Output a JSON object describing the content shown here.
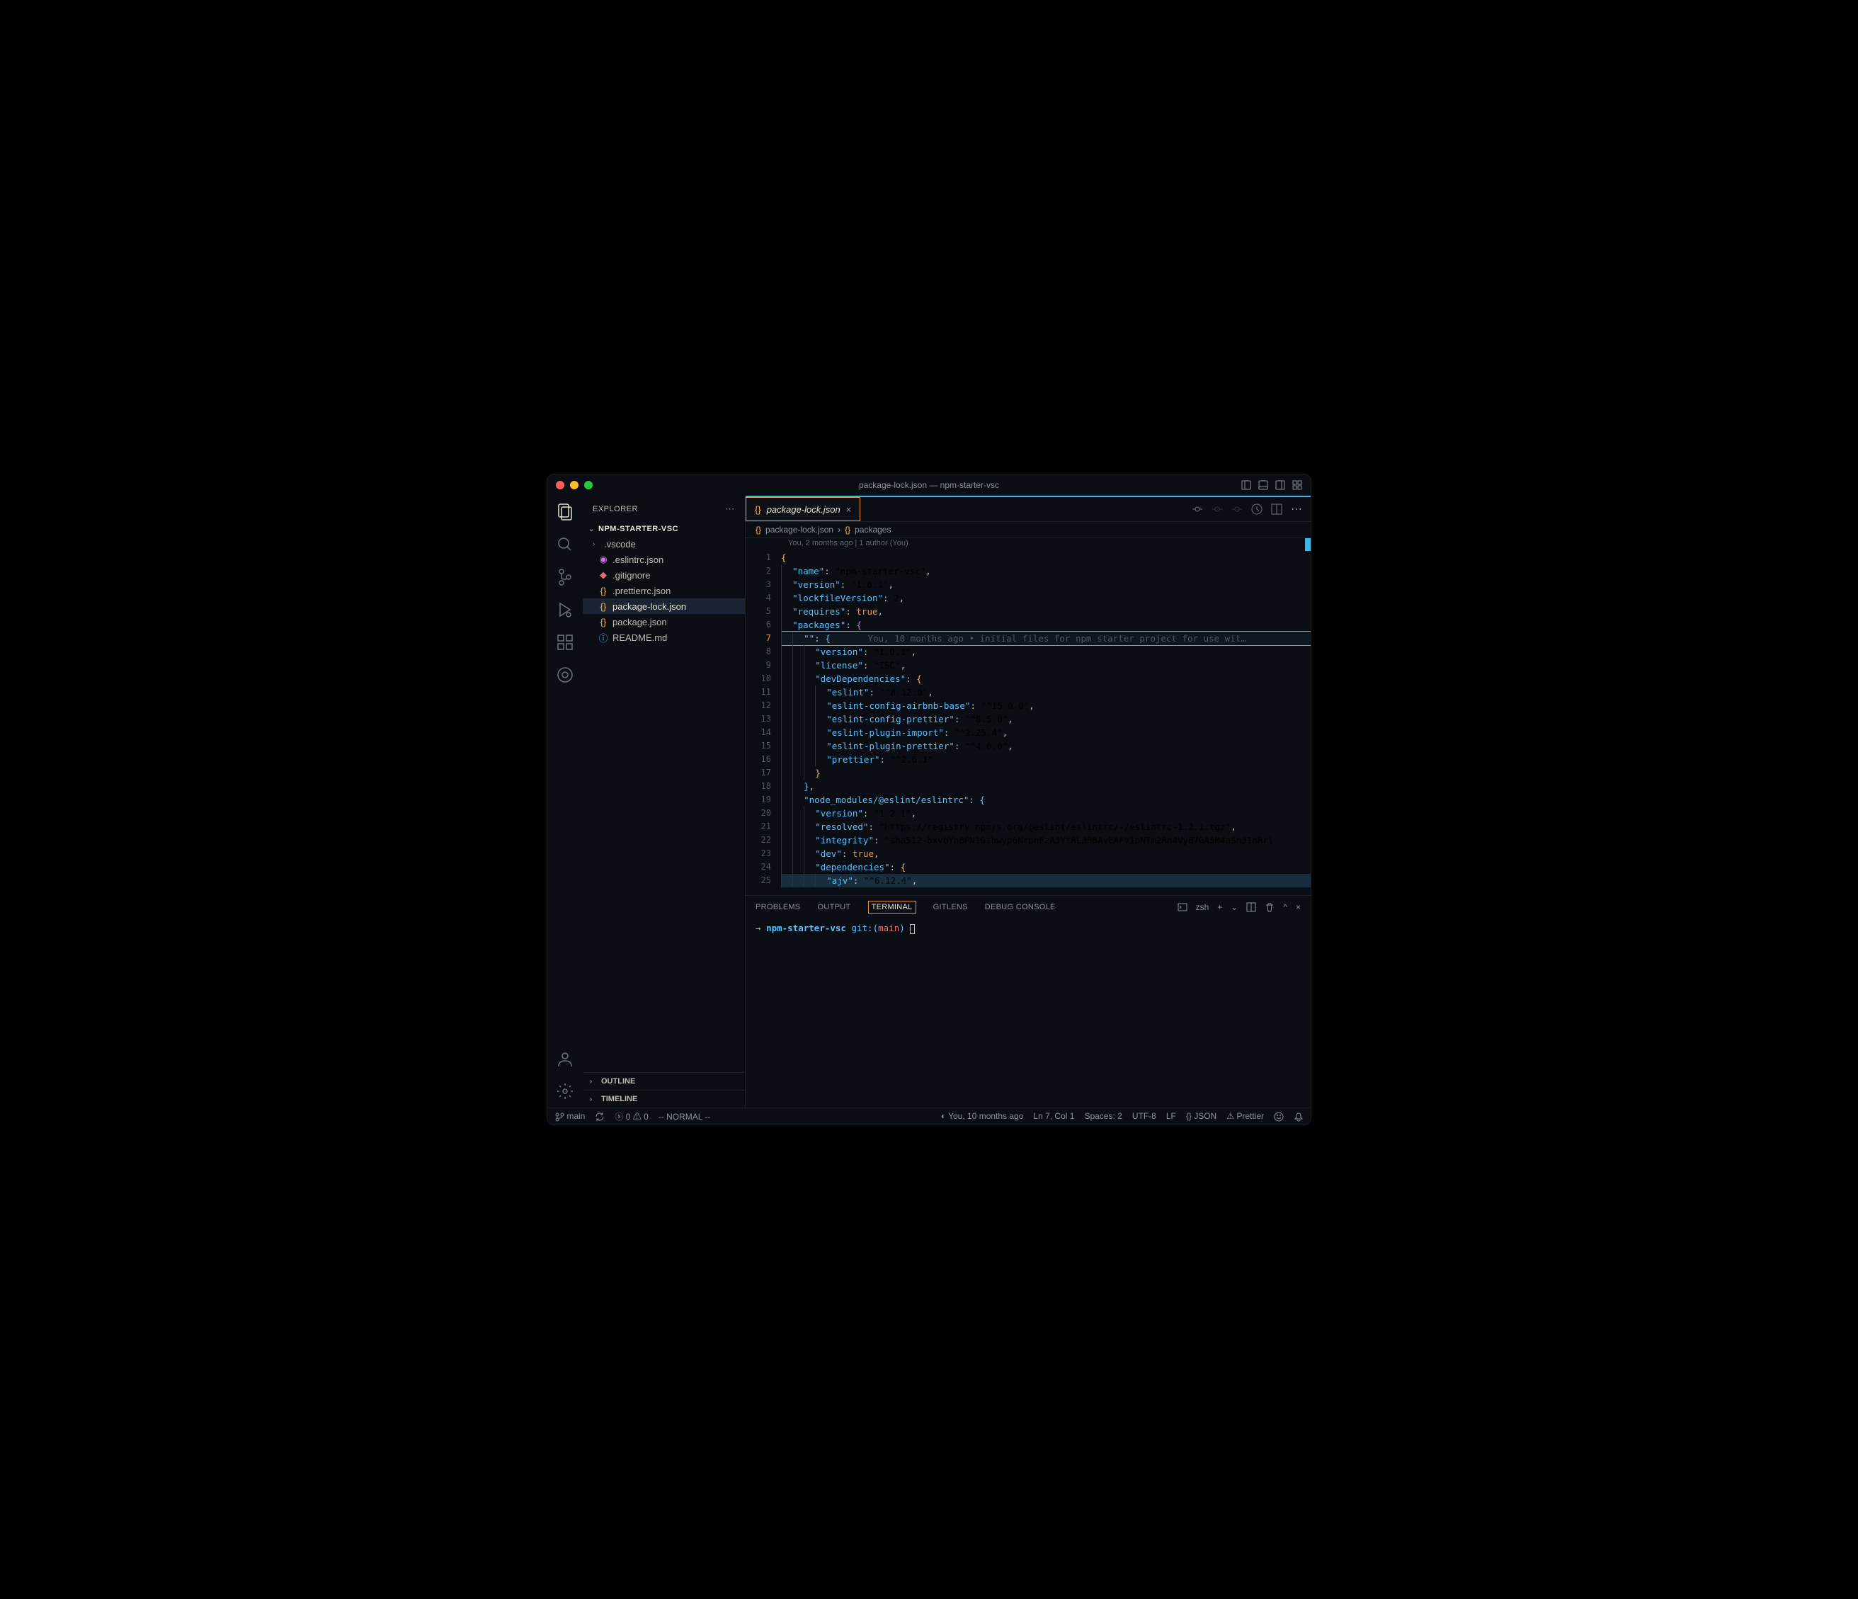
{
  "titlebar": {
    "title": "package-lock.json — npm-starter-vsc"
  },
  "sidebar": {
    "header": "EXPLORER",
    "folder": "NPM-STARTER-VSC",
    "items": [
      {
        "label": ".vscode",
        "type": "folder"
      },
      {
        "label": ".eslintrc.json",
        "type": "file",
        "icon": "settings"
      },
      {
        "label": ".gitignore",
        "type": "file",
        "icon": "git"
      },
      {
        "label": ".prettierrc.json",
        "type": "file",
        "icon": "json"
      },
      {
        "label": "package-lock.json",
        "type": "file",
        "icon": "json",
        "active": true
      },
      {
        "label": "package.json",
        "type": "file",
        "icon": "json"
      },
      {
        "label": "README.md",
        "type": "file",
        "icon": "info"
      }
    ],
    "outline": "OUTLINE",
    "timeline": "TIMELINE"
  },
  "tabs": {
    "active": {
      "label": "package-lock.json"
    }
  },
  "breadcrumb": {
    "parts": [
      "package-lock.json",
      "packages"
    ]
  },
  "blame": {
    "header": "You, 2 months ago | 1 author (You)",
    "inline": "You, 10 months ago • initial files for npm starter project for use wit…"
  },
  "code": {
    "lines": [
      "{",
      "  \"name\": \"npm-starter-vsc\",",
      "  \"version\": \"1.0.1\",",
      "  \"lockfileVersion\": 2,",
      "  \"requires\": true,",
      "  \"packages\": {",
      "    \"\": {",
      "      \"version\": \"1.0.1\",",
      "      \"license\": \"ISC\",",
      "      \"devDependencies\": {",
      "        \"eslint\": \"^8.12.0\",",
      "        \"eslint-config-airbnb-base\": \"^15.0.0\",",
      "        \"eslint-config-prettier\": \"^8.5.0\",",
      "        \"eslint-plugin-import\": \"^2.25.4\",",
      "        \"eslint-plugin-prettier\": \"^4.0.0\",",
      "        \"prettier\": \"^2.6.1\"",
      "      }",
      "    },",
      "    \"node_modules/@eslint/eslintrc\": {",
      "      \"version\": \"1.2.1\",",
      "      \"resolved\": \"https://registry.npmjs.org/@eslint/eslintrc/-/eslintrc-1.2.1.tgz\",",
      "      \"integrity\": \"sha512-bxvbYnBPN1Gibwyp6NrpnFzA3YtRL3BBAyEAFVIpNTm2Rn4Vy87GA5M4aSn3InRrl",
      "      \"dev\": true,",
      "      \"dependencies\": {",
      "        \"ajv\": \"^6.12.4\","
    ],
    "cursor_line": 7
  },
  "panel": {
    "tabs": [
      "PROBLEMS",
      "OUTPUT",
      "TERMINAL",
      "GITLENS",
      "DEBUG CONSOLE"
    ],
    "active": "TERMINAL",
    "shell": "zsh"
  },
  "terminal": {
    "arrow": "→",
    "cwd": "npm-starter-vsc",
    "git_label": "git:",
    "branch": "main"
  },
  "statusbar": {
    "branch": "main",
    "errors": "0",
    "warnings": "0",
    "mode": "-- NORMAL --",
    "blame": "You, 10 months ago",
    "cursor": "Ln 7, Col 1",
    "spaces": "Spaces: 2",
    "encoding": "UTF-8",
    "eol": "LF",
    "lang": "JSON",
    "prettier": "Prettier"
  }
}
